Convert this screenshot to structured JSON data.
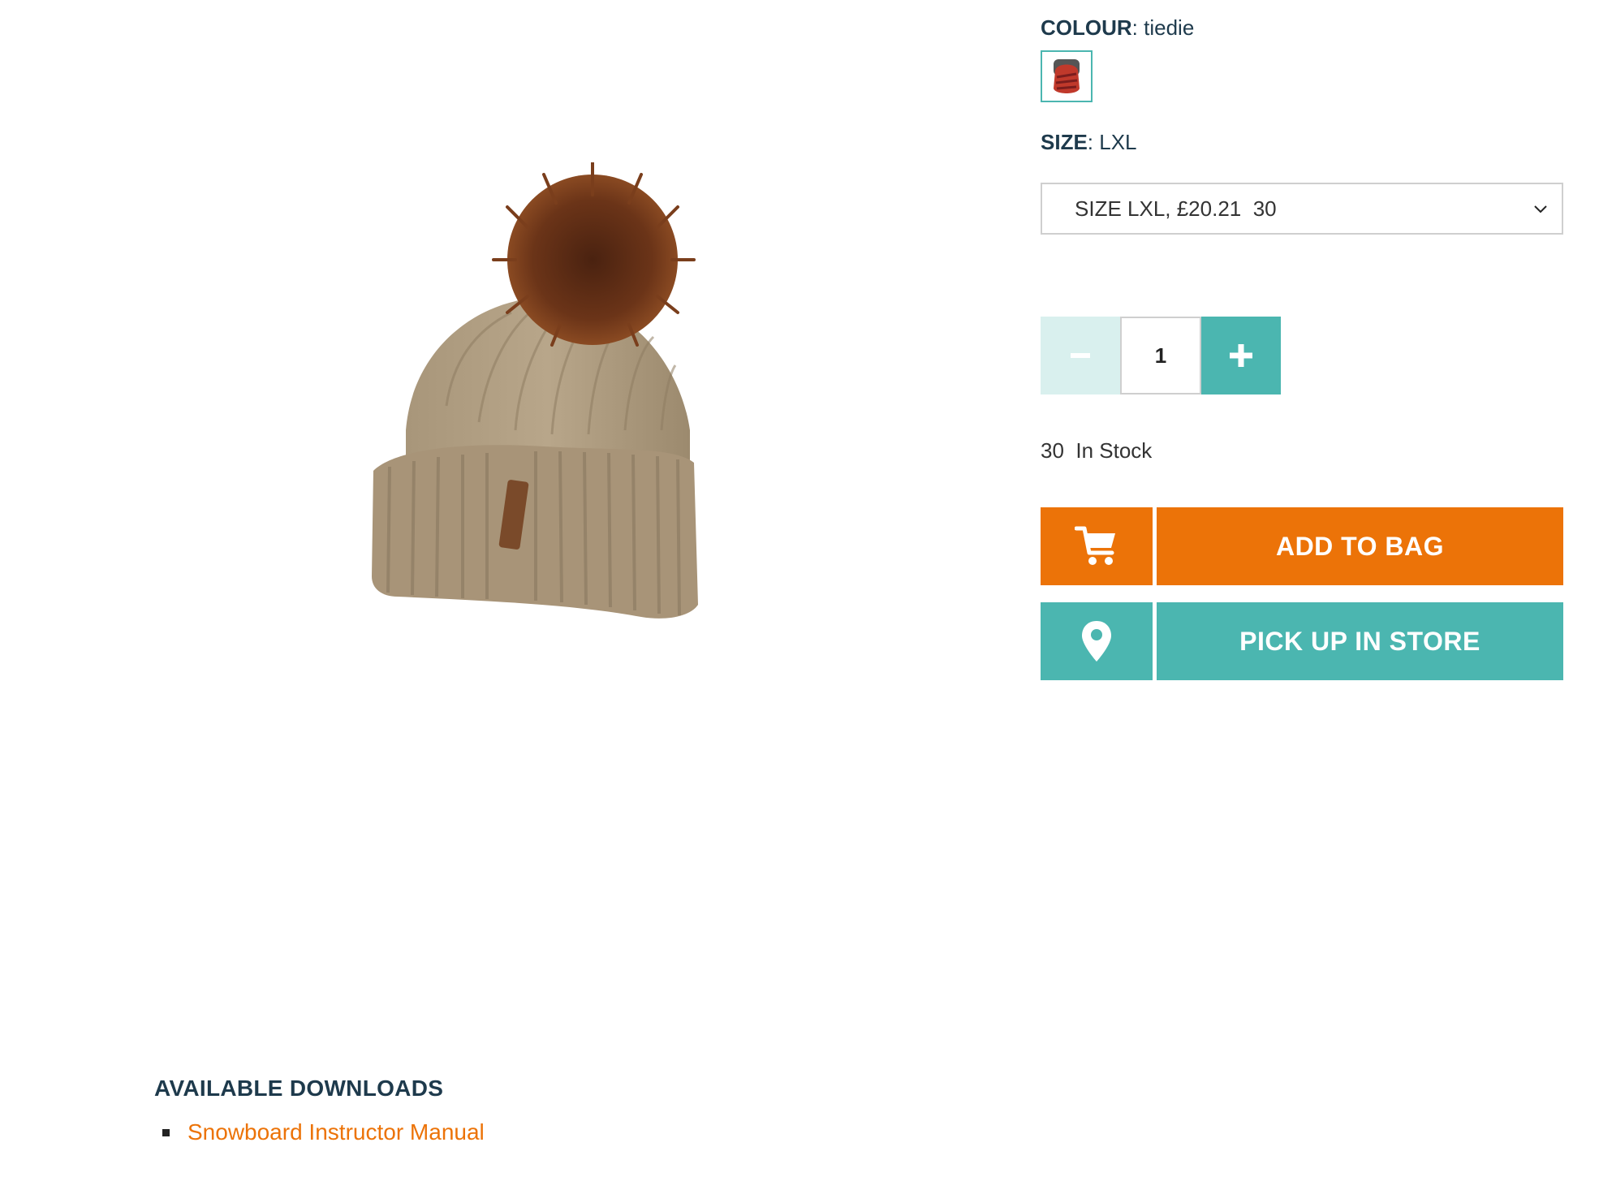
{
  "product": {
    "image_alt": "Beige knitted beanie with brown fur pom-pom"
  },
  "colour": {
    "key": "COLOUR",
    "value": "tiedie",
    "swatch_icon": "tiedie-swatch"
  },
  "size": {
    "key": "SIZE",
    "value": "LXL",
    "selected_option": "SIZE LXL, £20.21  30"
  },
  "quantity": {
    "value": "1",
    "minus_icon": "minus-icon",
    "plus_icon": "plus-icon"
  },
  "stock": {
    "text": "30  In Stock"
  },
  "actions": {
    "add_to_bag": "ADD TO BAG",
    "pick_up": "PICK UP IN STORE"
  },
  "downloads": {
    "heading": "AVAILABLE DOWNLOADS",
    "items": [
      {
        "label": "Snowboard Instructor Manual"
      }
    ]
  },
  "colors": {
    "teal": "#4bb6b0",
    "teal_light": "#d9f0ee",
    "orange": "#ec7308",
    "navy": "#1e3a4c"
  }
}
